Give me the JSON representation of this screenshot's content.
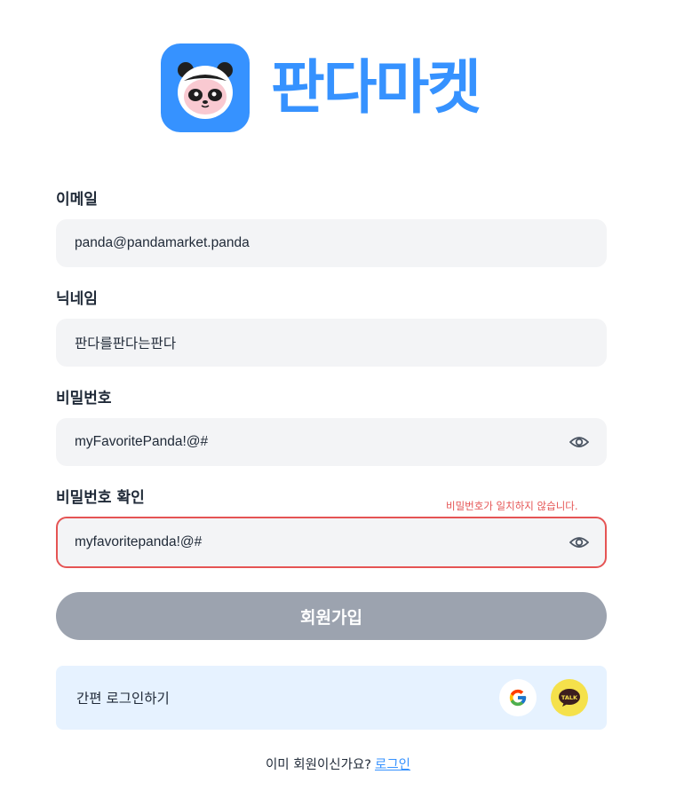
{
  "brand": {
    "name": "판다마켓",
    "color": "#3692ff",
    "icon": "panda-icon"
  },
  "form": {
    "email": {
      "label": "이메일",
      "value": "panda@pandamarket.panda"
    },
    "nickname": {
      "label": "닉네임",
      "value": "판다를판다는판다"
    },
    "password": {
      "label": "비밀번호",
      "value": "myFavoritePanda!@#",
      "toggle_icon": "eye-icon"
    },
    "password_confirm": {
      "label": "비밀번호 확인",
      "value": "myfavoritepanda!@#",
      "error": "비밀번호가 일치하지 않습니다.",
      "error_color": "#e55454",
      "toggle_icon": "eye-icon"
    },
    "submit_label": "회원가입",
    "submit_color": "#9ca3af"
  },
  "easy_login": {
    "label": "간편 로그인하기",
    "providers": [
      {
        "name": "Google",
        "icon": "google-icon"
      },
      {
        "name": "Kakao",
        "icon": "kakao-talk-icon",
        "badge": "TALK"
      }
    ]
  },
  "footer": {
    "prompt": "이미 회원이신가요?",
    "link": "로그인"
  }
}
